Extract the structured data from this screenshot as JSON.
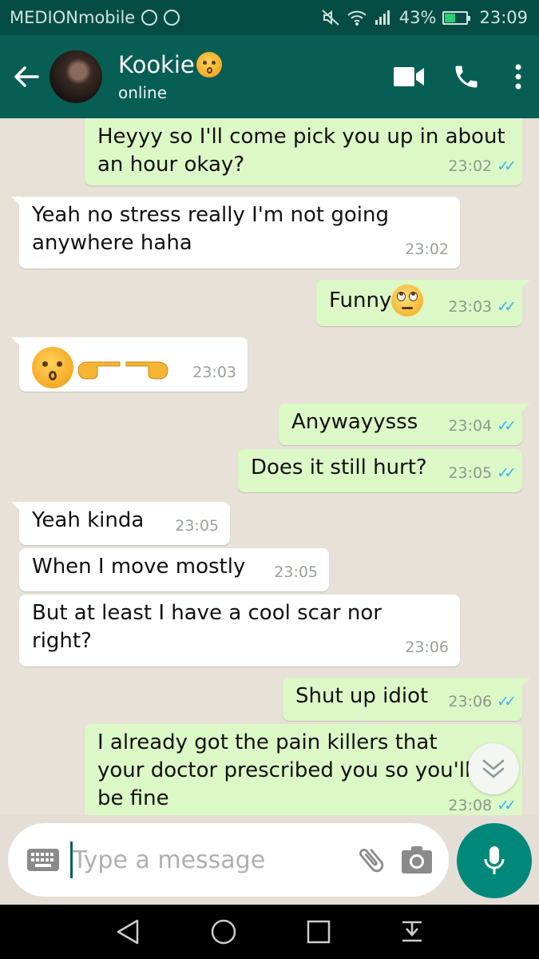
{
  "status_bar": {
    "carrier": "MEDIONmobile",
    "battery": "43%",
    "battery_level": 0.43,
    "time": "23:09"
  },
  "header": {
    "contact_name": "Kookie",
    "contact_status": "online",
    "icons": [
      "back-arrow-icon",
      "video-call-icon",
      "phone-icon",
      "more-vert-icon"
    ]
  },
  "messages": [
    {
      "dir": "out",
      "text": "Heyyy so I'll come pick you up in about an hour okay?",
      "time": "23:02",
      "read": true
    },
    {
      "dir": "in",
      "text": "Yeah no stress really I'm not going anywhere haha",
      "time": "23:02"
    },
    {
      "dir": "out",
      "text": "Funny",
      "time": "23:03",
      "read": true,
      "emoji": "eye-roll-face"
    },
    {
      "dir": "in",
      "text": "",
      "time": "23:03",
      "emoji": "kissing-face, pointing-hands"
    },
    {
      "dir": "out",
      "text": "Anywayysss",
      "time": "23:04",
      "read": true
    },
    {
      "dir": "out",
      "text": "Does it still hurt?",
      "time": "23:05",
      "read": true
    },
    {
      "dir": "in",
      "text": "Yeah kinda",
      "time": "23:05"
    },
    {
      "dir": "in",
      "text": "When I move mostly",
      "time": "23:05"
    },
    {
      "dir": "in",
      "text": "But at least I have a cool scar nor right?",
      "time": "23:06"
    },
    {
      "dir": "out",
      "text": "Shut up idiot",
      "time": "23:06",
      "read": true
    },
    {
      "dir": "out",
      "text": "I already got the pain killers that your doctor prescribed you so you'll be fine",
      "time": "23:08",
      "read": true
    }
  ],
  "input": {
    "placeholder": "Type a message"
  },
  "colors": {
    "header": "#075e54",
    "status_bar": "#054d44",
    "outgoing_bubble": "#dcf8c6",
    "incoming_bubble": "#ffffff",
    "read_ticks": "#34b7f1",
    "mic_button": "#00897b"
  }
}
